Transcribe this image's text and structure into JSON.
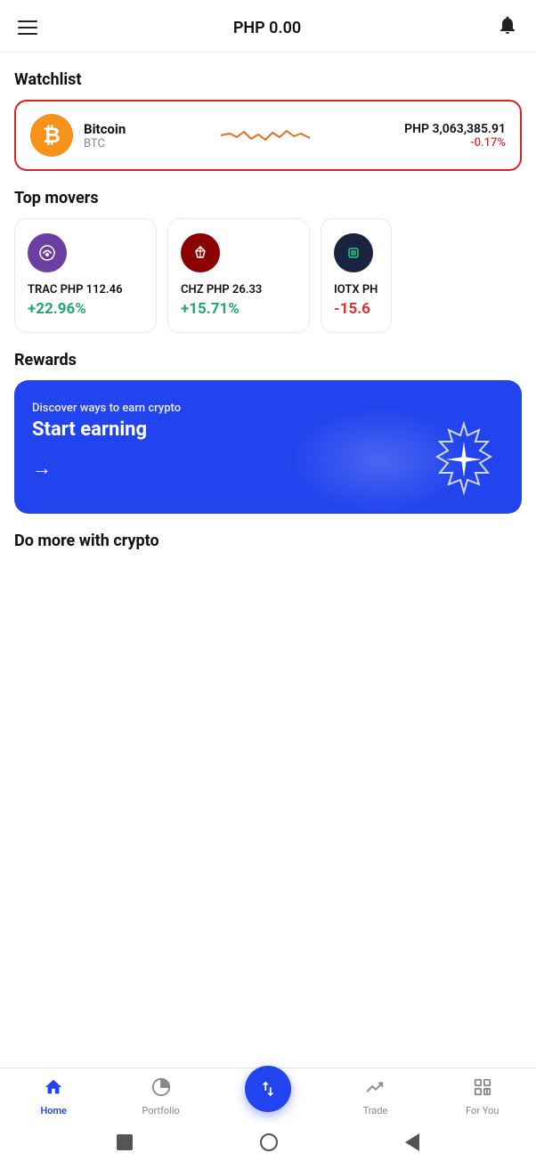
{
  "header": {
    "balance": "PHP 0.00",
    "menu_label": "menu",
    "bell_label": "notifications"
  },
  "watchlist": {
    "section_title": "Watchlist",
    "coin": {
      "name": "Bitcoin",
      "symbol": "BTC",
      "price": "PHP 3,063,385.91",
      "change": "-0.17%",
      "change_positive": false
    }
  },
  "top_movers": {
    "section_title": "Top movers",
    "coins": [
      {
        "symbol": "TRAC",
        "price": "PHP 112.46",
        "change": "+22.96%",
        "positive": true,
        "logo": "TRAC"
      },
      {
        "symbol": "CHZ",
        "price": "PHP 26.33",
        "change": "+15.71%",
        "positive": true,
        "logo": "CHZ"
      },
      {
        "symbol": "IOTX",
        "price": "PH...",
        "change": "-15.6",
        "positive": false,
        "logo": "IOTX"
      }
    ]
  },
  "rewards": {
    "section_title": "Rewards",
    "subtitle": "Discover ways to earn crypto",
    "title": "Start earning",
    "arrow": "→"
  },
  "do_more": {
    "section_title": "Do more with crypto"
  },
  "bottom_nav": {
    "items": [
      {
        "label": "Home",
        "active": true,
        "icon": "home"
      },
      {
        "label": "Portfolio",
        "active": false,
        "icon": "portfolio"
      },
      {
        "label": "",
        "active": false,
        "icon": "swap"
      },
      {
        "label": "Trade",
        "active": false,
        "icon": "trade"
      },
      {
        "label": "For You",
        "active": false,
        "icon": "foryou"
      }
    ]
  }
}
